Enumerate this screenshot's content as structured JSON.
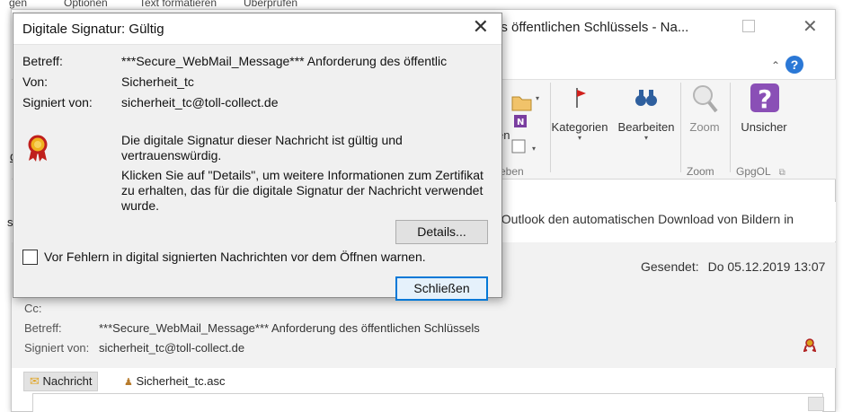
{
  "menu_strip": {
    "items": [
      "gen",
      "Optionen",
      "Text formatieren",
      "Überprüfen"
    ]
  },
  "background_window": {
    "title": "es öffentlichen Schlüssels - Na...",
    "ribbon_groups": [
      {
        "label": "Kategorien",
        "icon": "flag-icon"
      },
      {
        "label": "Bearbeiten",
        "icon": "binoculars-icon"
      },
      {
        "label": "Zoom",
        "icon": "zoom-icon"
      },
      {
        "label": "Unsicher",
        "icon": "question-icon"
      }
    ],
    "partial_left_label": "en",
    "group_labels": {
      "left": "eben",
      "zoom": "Zoom",
      "gpgol": "GpgOL"
    },
    "left_d": "d",
    "left_s": "s",
    "info_bar_text": "t Outlook den automatischen Download von Bildern in",
    "sent_label": "Gesendet:",
    "sent_value": "Do 05.12.2019 13:07",
    "cc_label": "Cc:",
    "subject_label": "Betreff:",
    "subject_value": "***Secure_WebMail_Message*** Anforderung des öffentlichen Schlüssels",
    "signed_label": "Signiert von:",
    "signed_value": "sicherheit_tc@toll-collect.de",
    "tab_message": "Nachricht",
    "tab_attachment": "Sicherheit_tc.asc"
  },
  "dialog": {
    "title": "Digitale Signatur: Gültig",
    "fields": [
      {
        "label": "Betreff:",
        "value": "***Secure_WebMail_Message*** Anforderung des öffentlic"
      },
      {
        "label": "Von:",
        "value": "Sicherheit_tc"
      },
      {
        "label": "Signiert von:",
        "value": "sicherheit_tc@toll-collect.de"
      }
    ],
    "status_message": "Die digitale Signatur dieser Nachricht ist gültig und vertrauenswürdig.",
    "details_message": "Klicken Sie auf \"Details\", um weitere Informationen zum Zertifikat zu erhalten, das für die digitale Signatur der Nachricht verwendet wurde.",
    "details_button": "Details...",
    "warn_checkbox_label": "Vor Fehlern in digital signierten Nachrichten vor dem Öffnen warnen.",
    "warn_checked": false,
    "close_button": "Schließen"
  }
}
